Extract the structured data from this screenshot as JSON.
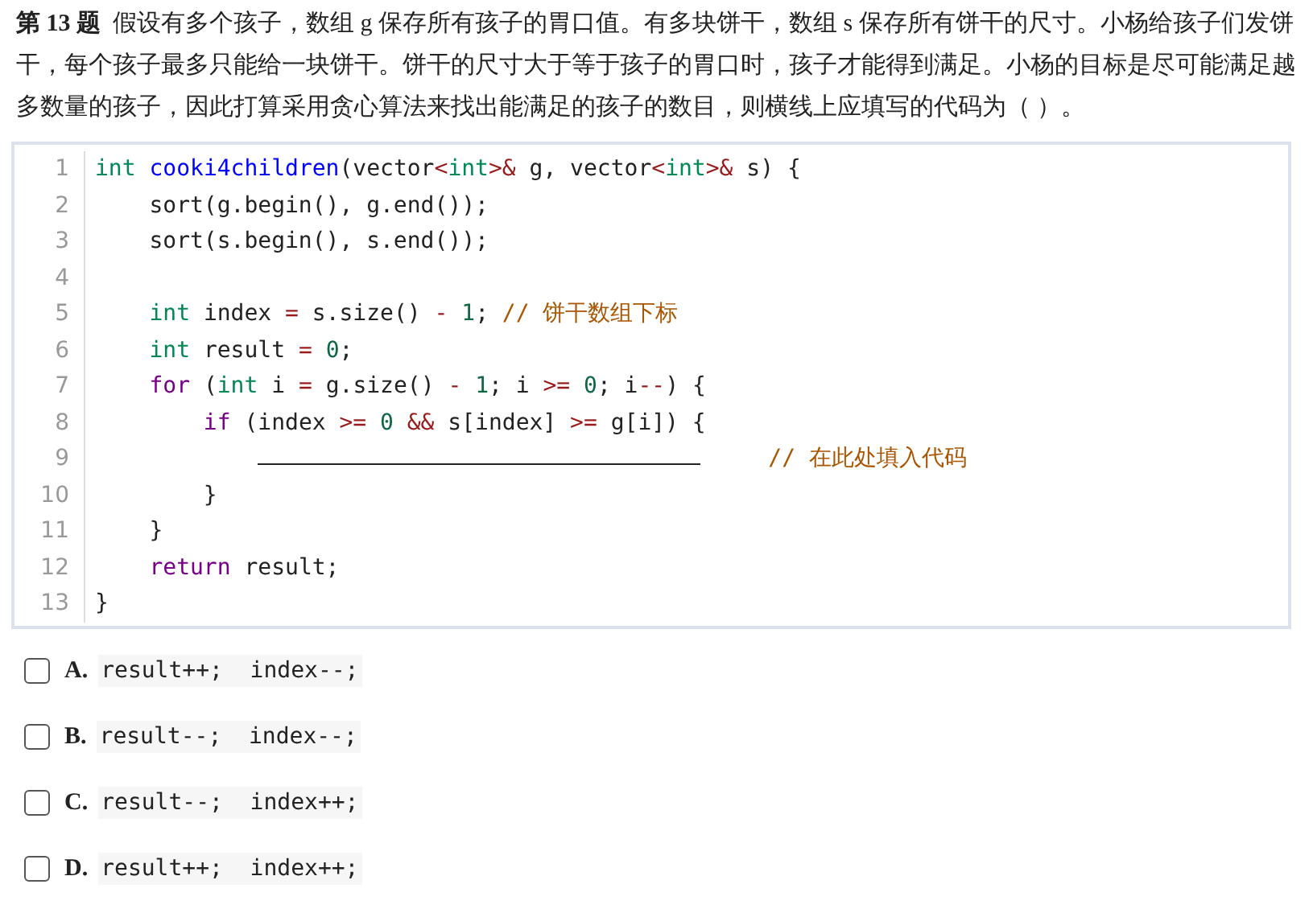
{
  "question": {
    "number": "第 13 题",
    "text": "假设有多个孩子，数组 g 保存所有孩子的胃口值。有多块饼干，数组 s 保存所有饼干的尺寸。小杨给孩子们发饼干，每个孩子最多只能给一块饼干。饼干的尺寸大于等于孩子的胃口时，孩子才能得到满足。小杨的目标是尽可能满足越多数量的孩子，因此打算采用贪心算法来找出能满足的孩子的数目，则横线上应填写的代码为（ ）。"
  },
  "code": {
    "lines": [
      {
        "number": "1",
        "tokens": [
          {
            "kind": "type",
            "text": "int"
          },
          {
            "kind": "def",
            "text": " cooki4children"
          },
          {
            "kind": "plain",
            "text": "(vector"
          },
          {
            "kind": "op",
            "text": "<"
          },
          {
            "kind": "type",
            "text": "int"
          },
          {
            "kind": "op",
            "text": ">&"
          },
          {
            "kind": "plain",
            "text": " g, vector"
          },
          {
            "kind": "op",
            "text": "<"
          },
          {
            "kind": "type",
            "text": "int"
          },
          {
            "kind": "op",
            "text": ">&"
          },
          {
            "kind": "plain",
            "text": " s) {"
          }
        ]
      },
      {
        "number": "2",
        "tokens": [
          {
            "kind": "plain",
            "text": "    sort(g.begin(), g.end());"
          }
        ]
      },
      {
        "number": "3",
        "tokens": [
          {
            "kind": "plain",
            "text": "    sort(s.begin(), s.end());"
          }
        ]
      },
      {
        "number": "4"
      },
      {
        "number": "5",
        "tokens": [
          {
            "kind": "type",
            "text": "    int"
          },
          {
            "kind": "plain",
            "text": " index "
          },
          {
            "kind": "op",
            "text": "="
          },
          {
            "kind": "plain",
            "text": " s.size() "
          },
          {
            "kind": "op",
            "text": "-"
          },
          {
            "kind": "num",
            "text": " 1"
          },
          {
            "kind": "plain",
            "text": "; "
          },
          {
            "kind": "comment",
            "text": "// 饼干数组下标"
          }
        ]
      },
      {
        "number": "6",
        "tokens": [
          {
            "kind": "type",
            "text": "    int"
          },
          {
            "kind": "plain",
            "text": " result "
          },
          {
            "kind": "op",
            "text": "="
          },
          {
            "kind": "num",
            "text": " 0"
          },
          {
            "kind": "plain",
            "text": ";"
          }
        ]
      },
      {
        "number": "7",
        "tokens": [
          {
            "kind": "keyword",
            "text": "    for"
          },
          {
            "kind": "plain",
            "text": " ("
          },
          {
            "kind": "type",
            "text": "int"
          },
          {
            "kind": "plain",
            "text": " i "
          },
          {
            "kind": "op",
            "text": "="
          },
          {
            "kind": "plain",
            "text": " g.size() "
          },
          {
            "kind": "op",
            "text": "-"
          },
          {
            "kind": "num",
            "text": " 1"
          },
          {
            "kind": "plain",
            "text": "; i "
          },
          {
            "kind": "op",
            "text": ">="
          },
          {
            "kind": "num",
            "text": " 0"
          },
          {
            "kind": "plain",
            "text": "; i"
          },
          {
            "kind": "op",
            "text": "--"
          },
          {
            "kind": "plain",
            "text": ") {"
          }
        ]
      },
      {
        "number": "8",
        "tokens": [
          {
            "kind": "keyword",
            "text": "        if"
          },
          {
            "kind": "plain",
            "text": " (index "
          },
          {
            "kind": "op",
            "text": ">="
          },
          {
            "kind": "num",
            "text": " 0"
          },
          {
            "kind": "op",
            "text": " &&"
          },
          {
            "kind": "plain",
            "text": " s[index] "
          },
          {
            "kind": "op",
            "text": ">="
          },
          {
            "kind": "plain",
            "text": " g[i]) {"
          }
        ]
      },
      {
        "number": "9",
        "tokens": [
          {
            "kind": "blank"
          },
          {
            "kind": "comment",
            "text": "// 在此处填入代码"
          }
        ]
      },
      {
        "number": "10",
        "tokens": [
          {
            "kind": "plain",
            "text": "        }"
          }
        ]
      },
      {
        "number": "11",
        "tokens": [
          {
            "kind": "plain",
            "text": "    }"
          }
        ]
      },
      {
        "number": "12",
        "tokens": [
          {
            "kind": "keyword",
            "text": "    return"
          },
          {
            "kind": "plain",
            "text": " result;"
          }
        ]
      },
      {
        "number": "13",
        "tokens": [
          {
            "kind": "plain",
            "text": "}"
          }
        ]
      }
    ]
  },
  "options": [
    {
      "letter": "A.",
      "code": "result++;  index--;",
      "checked": false
    },
    {
      "letter": "B.",
      "code": "result--;  index--;",
      "checked": false
    },
    {
      "letter": "C.",
      "code": "result--;  index++;",
      "checked": false
    },
    {
      "letter": "D.",
      "code": "result++;  index++;",
      "checked": false
    }
  ]
}
